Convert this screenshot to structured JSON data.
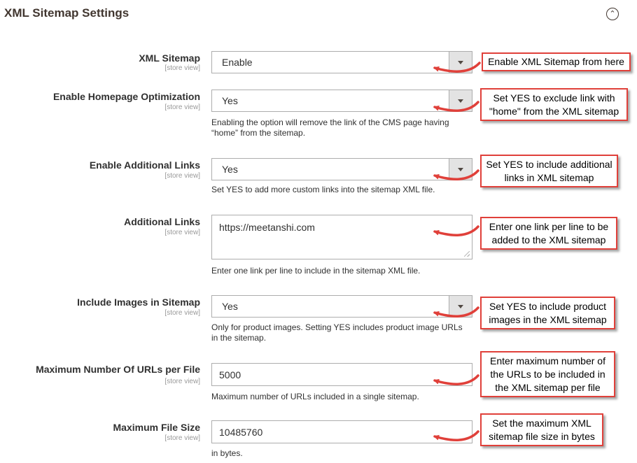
{
  "section": {
    "title": "XML Sitemap Settings",
    "collapse_icon": "chevron-up-circle-icon"
  },
  "fields": {
    "xml_sitemap": {
      "label": "XML Sitemap",
      "scope": "[store view]",
      "value": "Enable",
      "callout": "Enable XML Sitemap from here"
    },
    "homepage_opt": {
      "label": "Enable Homepage Optimization",
      "scope": "[store view]",
      "value": "Yes",
      "note": "Enabling the option will remove the link of the CMS page having “home” from the sitemap.",
      "callout": "Set YES to exclude link with \"home\" from the XML sitemap"
    },
    "additional_links_enable": {
      "label": "Enable Additional Links",
      "scope": "[store view]",
      "value": "Yes",
      "note": "Set YES to add more custom links into the sitemap XML file.",
      "callout": "Set YES to include additional links in XML sitemap"
    },
    "additional_links": {
      "label": "Additional Links",
      "scope": "[store view]",
      "value": "https://meetanshi.com",
      "note": "Enter one link per line to include in the sitemap XML file.",
      "callout": "Enter one link per line to be added to the XML sitemap"
    },
    "include_images": {
      "label": "Include Images in Sitemap",
      "scope": "[store view]",
      "value": "Yes",
      "note": "Only for product images. Setting YES includes product image URLs in the sitemap.",
      "callout": "Set YES to include product images in the XML sitemap"
    },
    "max_urls": {
      "label": "Maximum Number Of URLs per File",
      "scope": "[store view]",
      "value": "5000",
      "note": "Maximum number of URLs included in a single sitemap.",
      "callout": "Enter maximum number of the URLs to be included in the XML sitemap per file"
    },
    "max_file_size": {
      "label": "Maximum File Size",
      "scope": "[store view]",
      "value": "10485760",
      "note": "in bytes.",
      "callout": "Set the maximum XML sitemap file size in bytes"
    }
  },
  "colors": {
    "callout_border": "#e0403a",
    "arrow": "#e0403a",
    "title": "#41362f"
  }
}
